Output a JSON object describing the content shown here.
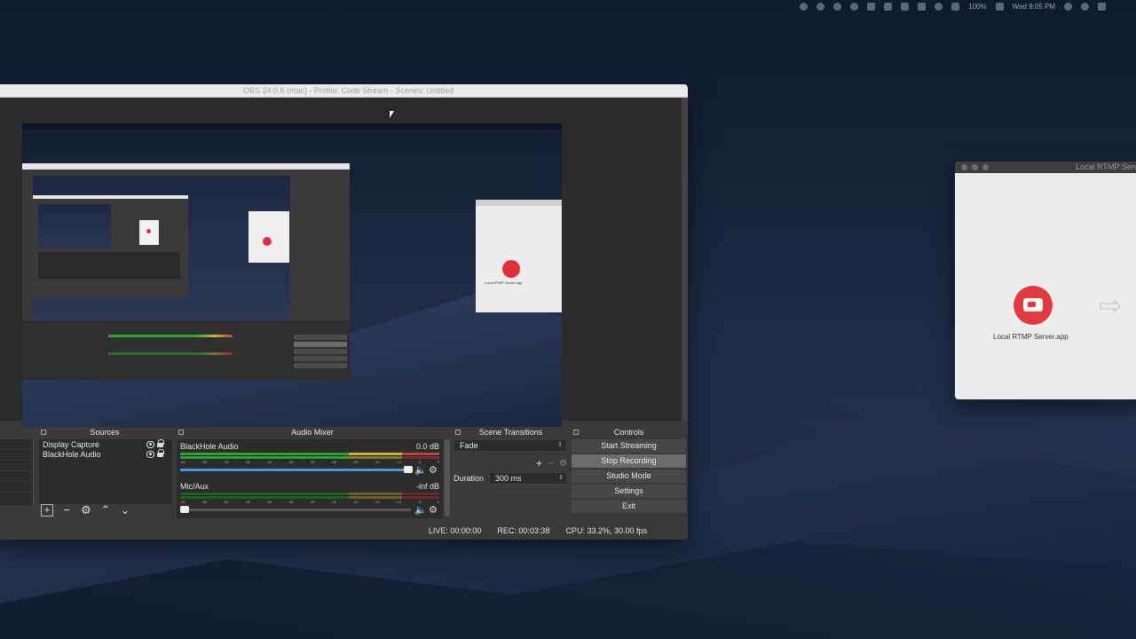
{
  "menubar": {
    "battery": "100%",
    "clock": "Wed 9:05 PM"
  },
  "obs": {
    "title": "OBS 24.0.6 (mac) - Profile: Code Stream - Scenes: Untitled",
    "docks": {
      "sources": "Sources",
      "mixer": "Audio Mixer",
      "transitions": "Scene Transitions",
      "controls": "Controls"
    },
    "sources": [
      {
        "label": "Display Capture"
      },
      {
        "label": "BlackHole Audio"
      }
    ],
    "mixer": {
      "tracks": [
        {
          "name": "BlackHole Audio",
          "level": "0.0 dB",
          "volume": 1.0
        },
        {
          "name": "Mic/Aux",
          "level": "-inf dB",
          "volume": 0.0
        }
      ],
      "ticks": [
        "-60",
        "-55",
        "-50",
        "-45",
        "-40",
        "-35",
        "-30",
        "-25",
        "-20",
        "-15",
        "-10",
        "-5",
        "0"
      ]
    },
    "transitions": {
      "selected": "Fade",
      "duration_label": "Duration",
      "duration_value": "300 ms"
    },
    "controls": {
      "start_streaming": "Start Streaming",
      "stop_recording": "Stop Recording",
      "studio_mode": "Studio Mode",
      "settings": "Settings",
      "exit": "Exit"
    },
    "status": {
      "live": "LIVE: 00:00:00",
      "rec": "REC: 00:03:38",
      "cpu": "CPU: 33.2%, 30.00 fps"
    }
  },
  "rtmp": {
    "title": "Local RTMP Serv",
    "app_label": "Local RTMP Server.app"
  },
  "colors": {
    "meter_green": "#29a62e",
    "meter_yellow": "#c9b52c",
    "meter_red": "#c43f3f",
    "app_red": "#e23a3e"
  }
}
